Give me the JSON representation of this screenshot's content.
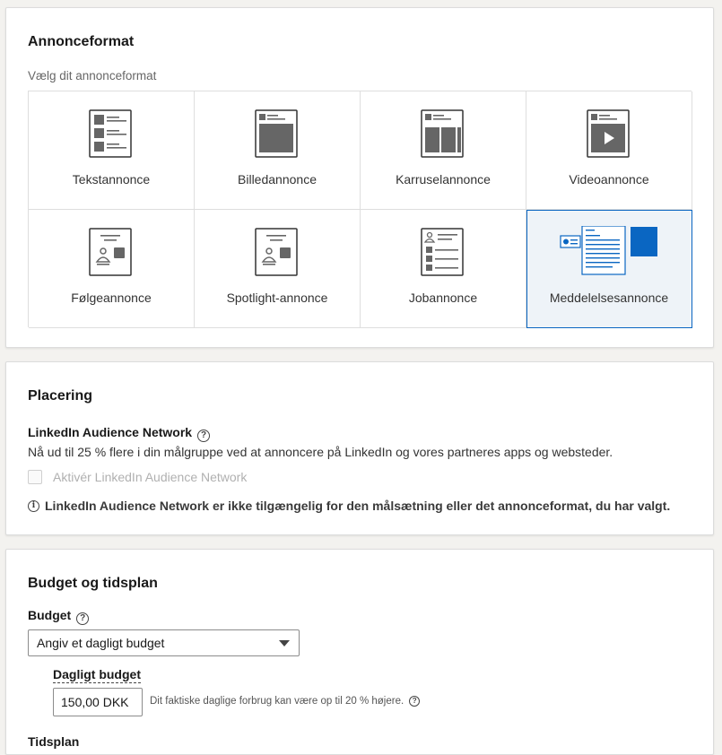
{
  "ad_format": {
    "title": "Annonceformat",
    "subtitle": "Vælg dit annonceformat",
    "tiles": [
      {
        "label": "Tekstannonce",
        "icon": "text-ad-icon"
      },
      {
        "label": "Billedannonce",
        "icon": "image-ad-icon"
      },
      {
        "label": "Karruselannonce",
        "icon": "carousel-ad-icon"
      },
      {
        "label": "Videoannonce",
        "icon": "video-ad-icon"
      },
      {
        "label": "Følgeannonce",
        "icon": "follower-ad-icon"
      },
      {
        "label": "Spotlight-annonce",
        "icon": "spotlight-ad-icon"
      },
      {
        "label": "Jobannonce",
        "icon": "job-ad-icon"
      },
      {
        "label": "Meddelelsesannonce",
        "icon": "message-ad-icon"
      }
    ],
    "selected": "Meddelelsesannonce"
  },
  "placement": {
    "title": "Placering",
    "network_label": "LinkedIn Audience Network",
    "network_desc": "Nå ud til 25 % flere i din målgruppe ved at annoncere på LinkedIn og vores partneres apps og websteder.",
    "checkbox_label": "Aktivér LinkedIn Audience Network",
    "info_text": "LinkedIn Audience Network er ikke tilgængelig for den målsætning eller det annonceformat, du har valgt."
  },
  "budget": {
    "title": "Budget og tidsplan",
    "budget_label": "Budget",
    "select_value": "Angiv et dagligt budget",
    "daily_label": "Dagligt budget",
    "daily_value": "150,00 DKK",
    "hint": "Dit faktiske daglige forbrug kan være op til 20 % højere.",
    "next_label": "Tidsplan"
  },
  "colors": {
    "accent": "#0a66c2",
    "icon_gray": "#666666",
    "selected_bg": "#eef3f8"
  }
}
